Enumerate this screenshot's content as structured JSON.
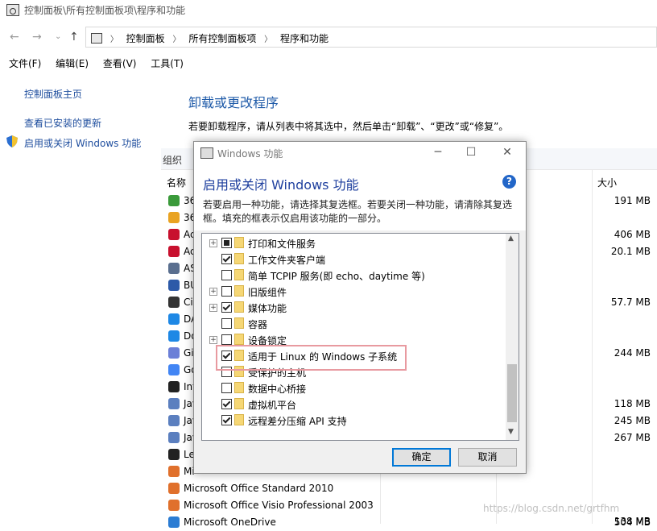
{
  "window": {
    "title": "控制面板\\所有控制面板项\\程序和功能"
  },
  "address": {
    "crumbs": [
      "控制面板",
      "所有控制面板项",
      "程序和功能"
    ]
  },
  "menu": [
    "文件(F)",
    "编辑(E)",
    "查看(V)",
    "工具(T)"
  ],
  "left": {
    "home": "控制面板主页",
    "updates": "查看已安装的更新",
    "features": "启用或关闭 Windows 功能"
  },
  "main": {
    "heading": "卸载或更改程序",
    "desc": "若要卸载程序，请从列表中将其选中，然后单击“卸载”、“更改”或“修复”。",
    "organize": "组织",
    "col_name": "名称",
    "col_size": "大小",
    "rows": [
      {
        "name": "36",
        "size": "191 MB",
        "icon": "#3a9a3a"
      },
      {
        "name": "36",
        "size": "",
        "icon": "#e9a322"
      },
      {
        "name": "Ac",
        "size": "406 MB",
        "icon": "#c8102e"
      },
      {
        "name": "Ac",
        "size": "20.1 MB",
        "icon": "#c8102e"
      },
      {
        "name": "AS",
        "size": "",
        "icon": "#5a6f8f"
      },
      {
        "name": "BU",
        "size": "",
        "icon": "#2d5aa8"
      },
      {
        "name": "Cit",
        "size": "57.7 MB",
        "icon": "#333333"
      },
      {
        "name": "DA",
        "size": "",
        "icon": "#1e88e5"
      },
      {
        "name": "Do",
        "size": "",
        "icon": "#1e88e5"
      },
      {
        "name": "Gi",
        "size": "244 MB",
        "icon": "#6b7fd7"
      },
      {
        "name": "Go",
        "size": "",
        "icon": "#4285f4"
      },
      {
        "name": "Int",
        "size": "",
        "icon": "#222222"
      },
      {
        "name": "Jav",
        "size": "118 MB",
        "icon": "#5b7fbf"
      },
      {
        "name": "Jav",
        "size": "245 MB",
        "icon": "#5b7fbf"
      },
      {
        "name": "Jav",
        "size": "267 MB",
        "icon": "#5b7fbf"
      },
      {
        "name": "Le",
        "size": "",
        "icon": "#222222"
      },
      {
        "name": "Mi",
        "size": "",
        "icon": "#e0702c"
      },
      {
        "name": "Microsoft Office Standard 2010",
        "size": "",
        "icon": "#e0702c"
      },
      {
        "name": "Microsoft Office Visio Professional 2003",
        "size": "",
        "icon": "#e0702c"
      },
      {
        "name": "Microsoft OneDrive",
        "size": "504 MB",
        "icon": "#2b7cd3"
      }
    ],
    "last_size": "138 MB"
  },
  "dialog": {
    "title": "Windows 功能",
    "header": "启用或关闭 Windows 功能",
    "help": "?",
    "desc": "若要启用一种功能，请选择其复选框。若要关闭一种功能，请清除其复选框。填充的框表示仅启用该功能的一部分。",
    "items": [
      {
        "label": "打印和文件服务",
        "state": "partial",
        "expand": true
      },
      {
        "label": "工作文件夹客户端",
        "state": "checked",
        "expand": false
      },
      {
        "label": "简单 TCPIP 服务(即 echo、daytime 等)",
        "state": "unchecked",
        "expand": false
      },
      {
        "label": "旧版组件",
        "state": "unchecked",
        "expand": true
      },
      {
        "label": "媒体功能",
        "state": "checked",
        "expand": true
      },
      {
        "label": "容器",
        "state": "unchecked",
        "expand": false
      },
      {
        "label": "设备锁定",
        "state": "unchecked",
        "expand": true
      },
      {
        "label": "适用于 Linux 的 Windows 子系统",
        "state": "checked",
        "expand": false
      },
      {
        "label": "受保护的主机",
        "state": "unchecked",
        "expand": false
      },
      {
        "label": "数据中心桥接",
        "state": "unchecked",
        "expand": false
      },
      {
        "label": "虚拟机平台",
        "state": "checked",
        "expand": false
      },
      {
        "label": "远程差分压缩 API 支持",
        "state": "checked",
        "expand": false
      }
    ],
    "ok": "确定",
    "cancel": "取消"
  },
  "watermark": "https://blog.csdn.net/grtfhm"
}
